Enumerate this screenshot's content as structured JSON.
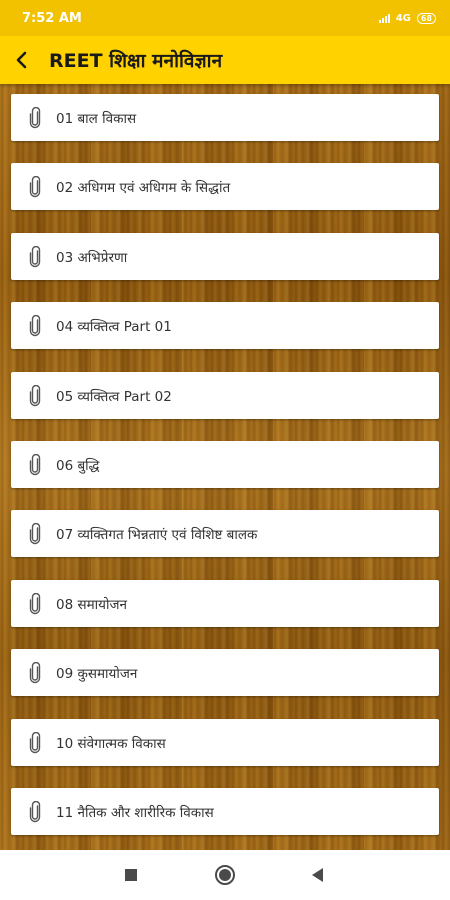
{
  "status_bar": {
    "time": "7:52 AM",
    "network": "4G",
    "battery": "68"
  },
  "app_bar": {
    "title": "REET शिक्षा मनोविज्ञान",
    "back_icon": "chevron-left-icon"
  },
  "chapters": [
    {
      "label": "01 बाल विकास"
    },
    {
      "label": "02 अधिगम एवं अधिगम के सिद्धांत"
    },
    {
      "label": "03 अभिप्रेरणा"
    },
    {
      "label": "04 व्यक्तित्व Part 01"
    },
    {
      "label": "05 व्यक्तित्व Part 02"
    },
    {
      "label": "06 बुद्धि"
    },
    {
      "label": "07 व्यक्तिगत भिन्नताएं एवं विशिष्ट बालक"
    },
    {
      "label": "08 समायोजन"
    },
    {
      "label": "09 कुसमायोजन"
    },
    {
      "label": "10 संवेगात्मक विकास"
    },
    {
      "label": "11 नैतिक और शारीरिक विकास"
    }
  ],
  "item_icon": "paperclip-icon",
  "nav_bar": {
    "icons": [
      "recents-square-icon",
      "home-circle-icon",
      "back-triangle-icon"
    ]
  },
  "colors": {
    "status_bar": "#f2c200",
    "app_bar": "#ffd200",
    "wood": "#9a6212"
  }
}
